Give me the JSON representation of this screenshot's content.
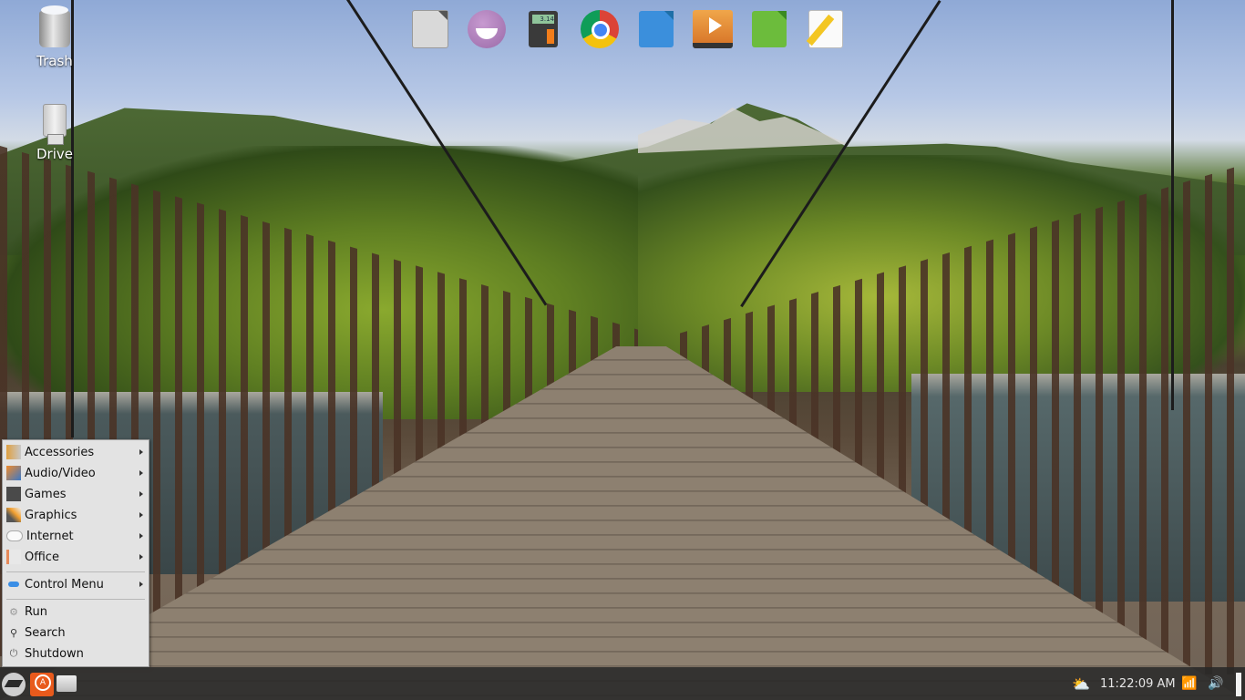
{
  "desktop": {
    "icons": [
      {
        "label": "Trash",
        "icon": "trash-icon"
      },
      {
        "label": "Drive",
        "icon": "usb-drive-icon"
      }
    ]
  },
  "dock": {
    "items": [
      {
        "name": "LibreOffice",
        "icon": "libreoffice-icon"
      },
      {
        "name": "Pidgin",
        "icon": "pidgin-smiley-icon"
      },
      {
        "name": "Calculator",
        "icon": "calculator-icon",
        "display": "3.14"
      },
      {
        "name": "Chromium",
        "icon": "chromium-icon"
      },
      {
        "name": "Writer",
        "icon": "writer-icon"
      },
      {
        "name": "Media Player",
        "icon": "media-player-icon"
      },
      {
        "name": "Calc",
        "icon": "spreadsheet-icon"
      },
      {
        "name": "Text Editor",
        "icon": "text-editor-icon"
      }
    ]
  },
  "menu": {
    "categories": [
      {
        "label": "Accessories",
        "icon": "accessories-icon",
        "submenu": true
      },
      {
        "label": "Audio/Video",
        "icon": "audio-video-icon",
        "submenu": true
      },
      {
        "label": "Games",
        "icon": "games-icon",
        "submenu": true
      },
      {
        "label": "Graphics",
        "icon": "graphics-icon",
        "submenu": true
      },
      {
        "label": "Internet",
        "icon": "internet-cloud-icon",
        "submenu": true
      },
      {
        "label": "Office",
        "icon": "office-icon",
        "submenu": true
      }
    ],
    "control": {
      "label": "Control Menu",
      "icon": "control-toggle-icon",
      "submenu": true
    },
    "actions": [
      {
        "label": "Run",
        "icon": "run-gears-icon"
      },
      {
        "label": "Search",
        "icon": "search-icon"
      },
      {
        "label": "Shutdown",
        "icon": "power-icon"
      }
    ]
  },
  "panel": {
    "launchers": [
      {
        "name": "Main Menu",
        "icon": "lxle-logo-icon"
      },
      {
        "name": "Catfish Search",
        "icon": "catfish-search-icon"
      },
      {
        "name": "Home Folder",
        "icon": "home-folder-icon"
      }
    ],
    "clock": "11:22:09 AM",
    "weather_icon": "partly-cloudy-icon",
    "network_icon": "wifi-icon",
    "volume_icon": "volume-icon"
  }
}
